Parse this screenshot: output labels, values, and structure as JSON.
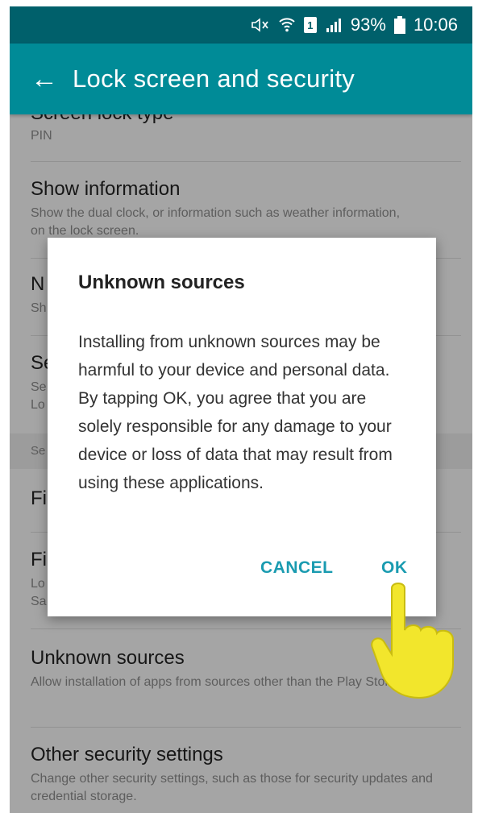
{
  "status_bar": {
    "battery_percent": "93%",
    "time": "10:06",
    "sim_label": "1"
  },
  "app_bar": {
    "title": "Lock screen and security"
  },
  "settings": {
    "screen_lock": {
      "title": "Screen lock type",
      "subtitle": "PIN"
    },
    "show_information": {
      "title": "Show information",
      "subtitle": "Show the dual clock, or information such as weather information, on the lock screen."
    },
    "notifications": {
      "title": "N",
      "subtitle": "Sh"
    },
    "secure_lock": {
      "title": "Se",
      "subtitle_1": "Se",
      "subtitle_2": "Lo"
    },
    "section_header": "Se",
    "find_my_mobile": {
      "title": "Fi"
    },
    "fingerprints": {
      "title": "Fi",
      "subtitle_1": "Lo",
      "subtitle_2": "Sa"
    },
    "unknown_sources": {
      "title": "Unknown sources",
      "subtitle": "Allow installation of apps from sources other than the Play Store."
    },
    "other_security": {
      "title": "Other security settings",
      "subtitle": "Change other security settings, such as those for security updates and credential storage."
    }
  },
  "dialog": {
    "title": "Unknown sources",
    "message": "Installing from unknown sources may be harmful to your device and personal data. By tapping OK, you agree that you are solely responsible for any damage to your device or loss of data that may result from using these applications.",
    "cancel_label": "CANCEL",
    "ok_label": "OK"
  },
  "colors": {
    "status_bar": "#00606b",
    "app_bar": "#008b97",
    "accent": "#1a9bb0",
    "hand": "#f2e62c"
  }
}
